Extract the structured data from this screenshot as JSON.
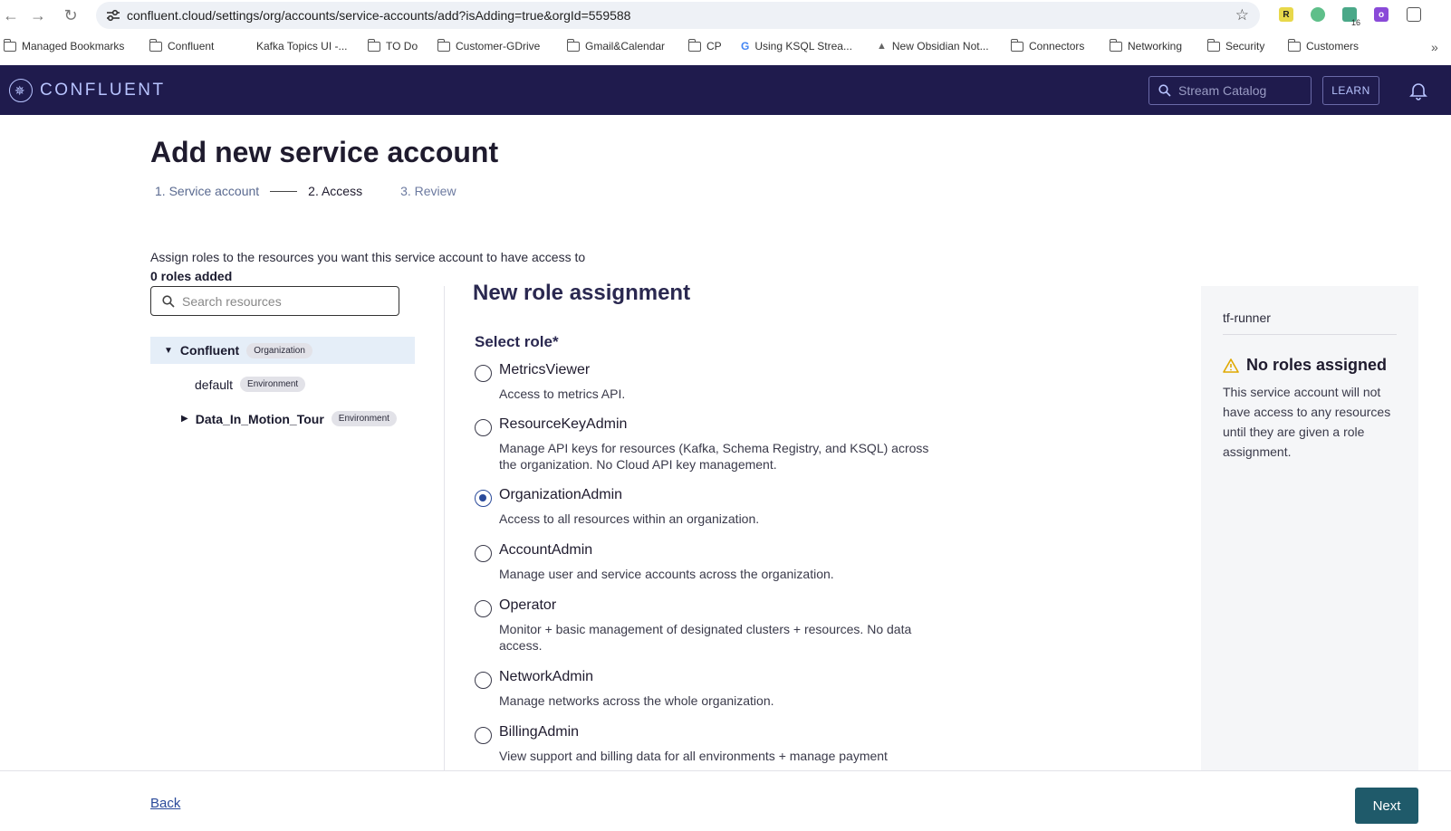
{
  "browser": {
    "url": "confluent.cloud/settings/org/accounts/service-accounts/add?isAdding=true&orgId=559588",
    "extension_badge": "16",
    "bookmarks": [
      "Managed Bookmarks",
      "Confluent",
      "Kafka Topics UI -...",
      "TO Do",
      "Customer-GDrive",
      "Gmail&Calendar",
      "CP",
      "Using KSQL Strea...",
      "New Obsidian Not...",
      "Connectors",
      "Networking",
      "Security",
      "Customers"
    ]
  },
  "header": {
    "logo_text": "CONFLUENT",
    "search_placeholder": "Stream Catalog",
    "learn_label": "LEARN"
  },
  "page": {
    "title": "Add new service account",
    "steps": [
      "1. Service account",
      "2. Access",
      "3. Review"
    ],
    "assign_description": "Assign roles to the resources you want this service account to have access to",
    "roles_added": "0 roles added",
    "resource_search_placeholder": "Search resources"
  },
  "tree": {
    "root": {
      "label": "Confluent",
      "badge": "Organization"
    },
    "children": [
      {
        "label": "default",
        "badge": "Environment"
      },
      {
        "label": "Data_In_Motion_Tour",
        "badge": "Environment"
      }
    ]
  },
  "role_assignment": {
    "title": "New role assignment",
    "select_label": "Select role*",
    "selected": "OrganizationAdmin",
    "roles": [
      {
        "name": "MetricsViewer",
        "description": "Access to metrics API."
      },
      {
        "name": "ResourceKeyAdmin",
        "description": "Manage API keys for resources (Kafka, Schema Registry, and KSQL) across the organization. No Cloud API key management."
      },
      {
        "name": "OrganizationAdmin",
        "description": "Access to all resources within an organization."
      },
      {
        "name": "AccountAdmin",
        "description": "Manage user and service accounts across the organization."
      },
      {
        "name": "Operator",
        "description": "Monitor + basic management of designated clusters + resources. No data access."
      },
      {
        "name": "NetworkAdmin",
        "description": "Manage networks across the whole organization."
      },
      {
        "name": "BillingAdmin",
        "description": "View support and billing data for all environments + manage payment"
      }
    ]
  },
  "side_panel": {
    "service_account_name": "tf-runner",
    "warning_title": "No roles assigned",
    "warning_text": "This service account will not have access to any resources until they are given a role assignment."
  },
  "footer": {
    "back_label": "Back",
    "next_label": "Next"
  },
  "colors": {
    "header_bg": "#1f1b4d",
    "next_button": "#1f5a6a",
    "warning": "#e0a800",
    "radio_selected": "#2a4a9a"
  }
}
